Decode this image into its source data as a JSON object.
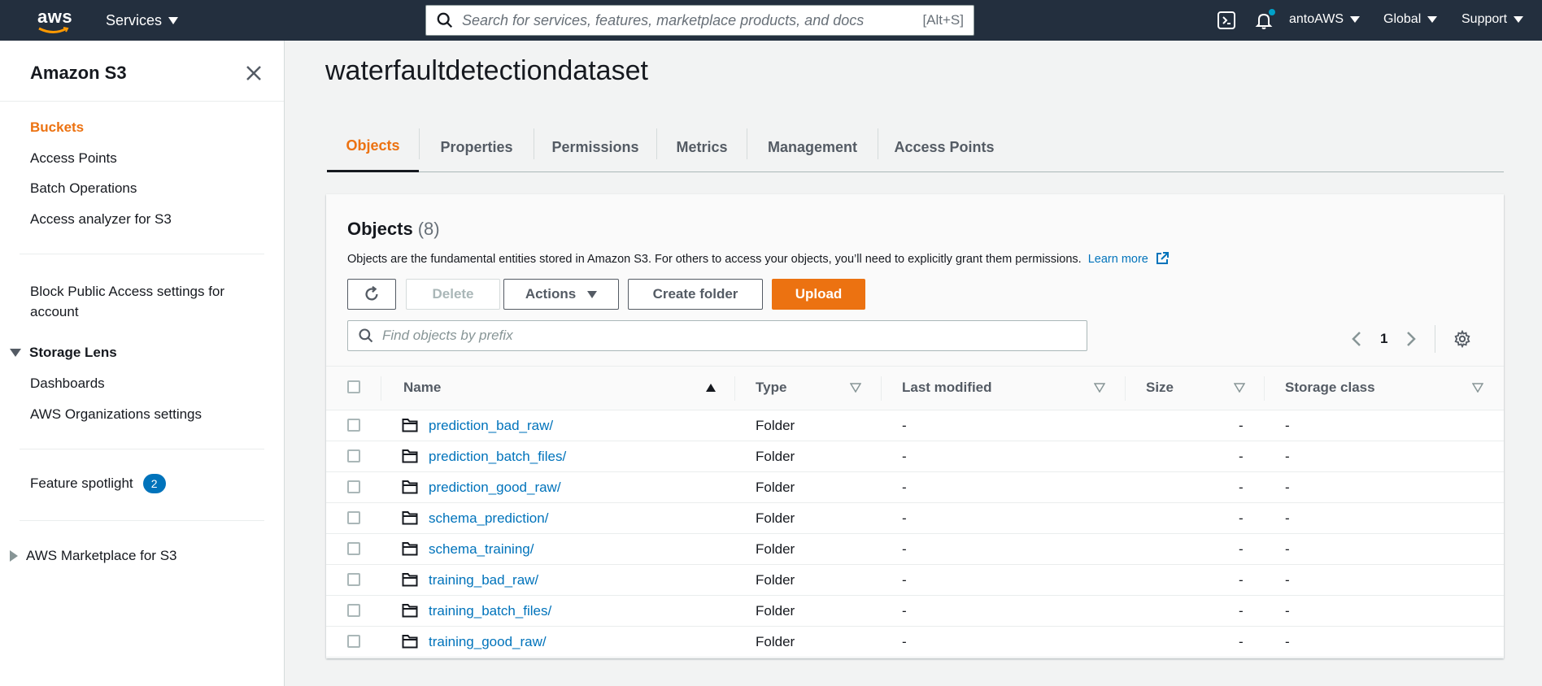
{
  "topnav": {
    "logo_text": "aws",
    "services_label": "Services",
    "search_placeholder": "Search for services, features, marketplace products, and docs",
    "search_shortcut": "[Alt+S]",
    "account_label": "antoAWS",
    "region_label": "Global",
    "support_label": "Support"
  },
  "sidebar": {
    "title": "Amazon S3",
    "items": [
      {
        "label": "Buckets"
      },
      {
        "label": "Access Points"
      },
      {
        "label": "Batch Operations"
      },
      {
        "label": "Access analyzer for S3"
      },
      {
        "label": "Block Public Access settings for account"
      },
      {
        "label": "Dashboards"
      },
      {
        "label": "AWS Organizations settings"
      }
    ],
    "storage_lens_label": "Storage Lens",
    "feature_spotlight_label": "Feature spotlight",
    "feature_spotlight_count": "2",
    "marketplace_label": "AWS Marketplace for S3"
  },
  "page": {
    "title": "waterfaultdetectiondataset"
  },
  "tabs": [
    "Objects",
    "Properties",
    "Permissions",
    "Metrics",
    "Management",
    "Access Points"
  ],
  "objects": {
    "title": "Objects",
    "count": "(8)",
    "description": "Objects are the fundamental entities stored in Amazon S3. For others to access your objects, you’ll need to explicitly grant them permissions.",
    "learn_more": "Learn more",
    "buttons": {
      "delete": "Delete",
      "actions": "Actions",
      "create_folder": "Create folder",
      "upload": "Upload"
    },
    "filter_placeholder": "Find objects by prefix",
    "page_number": "1",
    "columns": [
      "Name",
      "Type",
      "Last modified",
      "Size",
      "Storage class"
    ],
    "rows": [
      {
        "name": "prediction_bad_raw/",
        "type": "Folder",
        "last_modified": "-",
        "size": "-",
        "storage_class": "-"
      },
      {
        "name": "prediction_batch_files/",
        "type": "Folder",
        "last_modified": "-",
        "size": "-",
        "storage_class": "-"
      },
      {
        "name": "prediction_good_raw/",
        "type": "Folder",
        "last_modified": "-",
        "size": "-",
        "storage_class": "-"
      },
      {
        "name": "schema_prediction/",
        "type": "Folder",
        "last_modified": "-",
        "size": "-",
        "storage_class": "-"
      },
      {
        "name": "schema_training/",
        "type": "Folder",
        "last_modified": "-",
        "size": "-",
        "storage_class": "-"
      },
      {
        "name": "training_bad_raw/",
        "type": "Folder",
        "last_modified": "-",
        "size": "-",
        "storage_class": "-"
      },
      {
        "name": "training_batch_files/",
        "type": "Folder",
        "last_modified": "-",
        "size": "-",
        "storage_class": "-"
      },
      {
        "name": "training_good_raw/",
        "type": "Folder",
        "last_modified": "-",
        "size": "-",
        "storage_class": "-"
      }
    ]
  },
  "colors": {
    "nav_bg": "#232f3e",
    "accent_orange": "#ec7211",
    "link_blue": "#0073bb"
  }
}
